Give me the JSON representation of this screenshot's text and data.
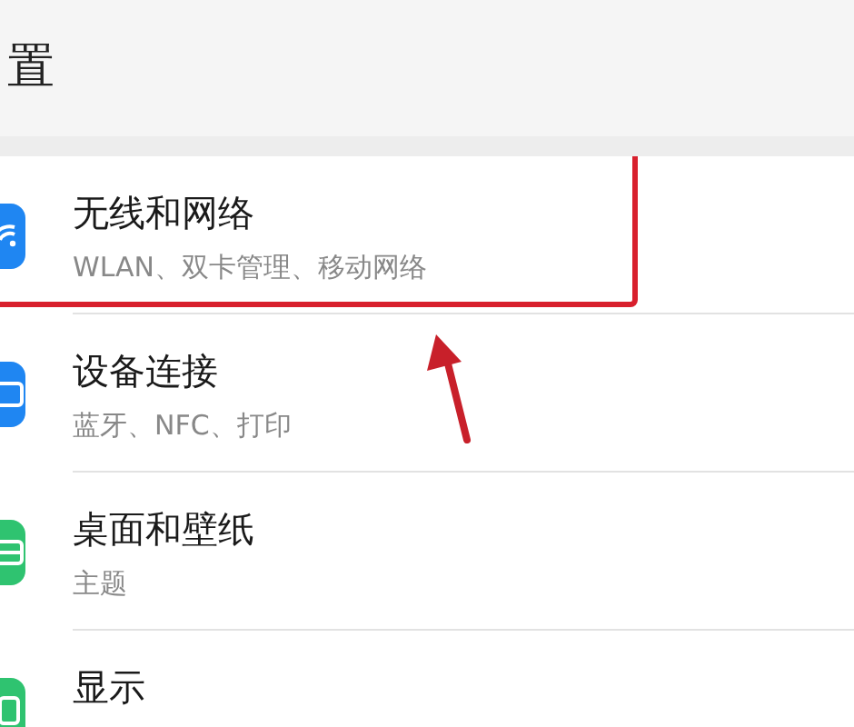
{
  "header": {
    "title": "置"
  },
  "items": [
    {
      "title": "无线和网络",
      "subtitle": "WLAN、双卡管理、移动网络",
      "color": "#1f86f2",
      "highlighted": true
    },
    {
      "title": "设备连接",
      "subtitle": "蓝牙、NFC、打印",
      "color": "#1f86f2",
      "highlighted": false
    },
    {
      "title": "桌面和壁纸",
      "subtitle": "主题",
      "color": "#2fc370",
      "highlighted": false
    },
    {
      "title": "显示",
      "color": "#2fc370",
      "highlighted": false
    }
  ]
}
